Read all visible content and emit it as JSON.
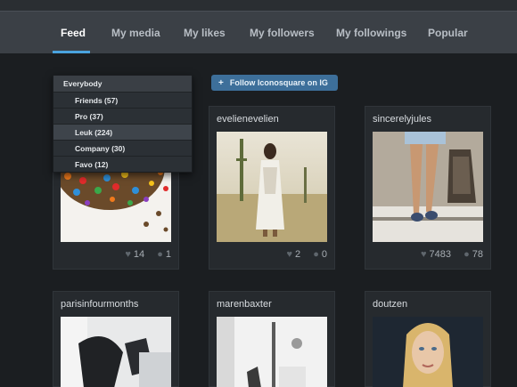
{
  "nav": {
    "tabs": [
      {
        "label": "Feed",
        "active": true
      },
      {
        "label": "My media"
      },
      {
        "label": "My likes"
      },
      {
        "label": "My followers"
      },
      {
        "label": "My followings"
      },
      {
        "label": "Popular"
      }
    ]
  },
  "filter": {
    "header": "Everybody",
    "options": [
      "Friends (57)",
      "Pro (37)",
      "Leuk (224)",
      "Company (30)",
      "Favo (12)"
    ],
    "selected": "Leuk (224)"
  },
  "follow_button": {
    "label": "Follow Iconosquare on IG",
    "icon": "plus-icon"
  },
  "posts": [
    {
      "user": "",
      "likes": "14",
      "comments": "1"
    },
    {
      "user": "evelienevelien",
      "likes": "2",
      "comments": "0"
    },
    {
      "user": "sincerelyjules",
      "likes": "7483",
      "comments": "78"
    },
    {
      "user": "parisinfourmonths"
    },
    {
      "user": "marenbaxter"
    },
    {
      "user": "doutzen"
    }
  ],
  "icons": {
    "like": "heart-icon",
    "comment": "comment-bubble-icon"
  },
  "colors": {
    "accent": "#4aa3df",
    "button": "#3d6f9a",
    "background": "#1b1e21"
  }
}
